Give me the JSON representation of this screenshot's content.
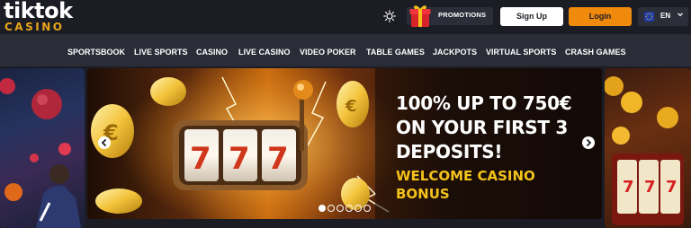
{
  "logo": {
    "main": "tiktok",
    "sub": "CASINO"
  },
  "header": {
    "promotions_label": "PROMOTIONS",
    "signup_label": "Sign Up",
    "login_label": "Login",
    "language": "EN",
    "icons": {
      "theme": "sun-icon",
      "promo": "gift-icon",
      "flag": "eu-flag-icon",
      "dropdown": "chevron-down-icon"
    }
  },
  "nav": {
    "items": [
      {
        "label": "SPORTSBOOK"
      },
      {
        "label": "LIVE SPORTS"
      },
      {
        "label": "CASINO"
      },
      {
        "label": "LIVE CASINO"
      },
      {
        "label": "VIDEO POKER"
      },
      {
        "label": "TABLE GAMES"
      },
      {
        "label": "JACKPOTS"
      },
      {
        "label": "VIRTUAL SPORTS"
      },
      {
        "label": "CRASH GAMES"
      }
    ]
  },
  "banner": {
    "title_lines": [
      "100% UP TO 750€",
      "ON YOUR FIRST 3",
      "DEPOSITS!"
    ],
    "subtitle_lines": [
      "WELCOME CASINO",
      "BONUS"
    ],
    "slot_reels": [
      "7",
      "7",
      "7"
    ],
    "carousel": {
      "total_slides": 6,
      "active_index": 0
    }
  },
  "colors": {
    "background": "#1c1d24",
    "nav_bg": "#2a2c37",
    "accent_orange": "#f08a0c",
    "logo_gold": "#e9a51a",
    "subtitle_yellow": "#f3c21b"
  }
}
